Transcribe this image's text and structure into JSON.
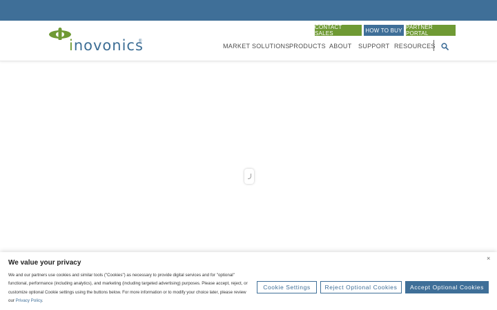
{
  "brand": {
    "name_prefix": "i",
    "name_rest": "novonics",
    "registered": "®"
  },
  "utility_links": {
    "contact_sales": "CONTACT SALES",
    "how_to_buy": "HOW TO BUY",
    "partner_portal": "PARTNER PORTAL"
  },
  "nav": {
    "items": [
      {
        "label": "MARKET SOLUTIONS"
      },
      {
        "label": "PRODUCTS"
      },
      {
        "label": "ABOUT"
      },
      {
        "label": "SUPPORT"
      },
      {
        "label": "RESOURCES"
      }
    ],
    "search_icon": "search-icon"
  },
  "cookie_banner": {
    "title": "We value your privacy",
    "body": "We and our partners use cookies and similar tools (\"Cookies\") as necessary to provide digital services and for \"optional\" functional, performance (including analytics), and marketing (including targeted advertising) purposes. Please accept, reject, or customize optional Cookie settings using the buttons below. For more information or to modify your choice later, please review our ",
    "policy_link": "Privacy Policy",
    "policy_suffix": ".",
    "close": "×",
    "buttons": {
      "settings": "Cookie Settings",
      "reject": "Reject Optional Cookies",
      "accept": "Accept Optional Cookies"
    }
  },
  "colors": {
    "brand_blue": "#3f6f98",
    "brand_green": "#6f9a34"
  }
}
